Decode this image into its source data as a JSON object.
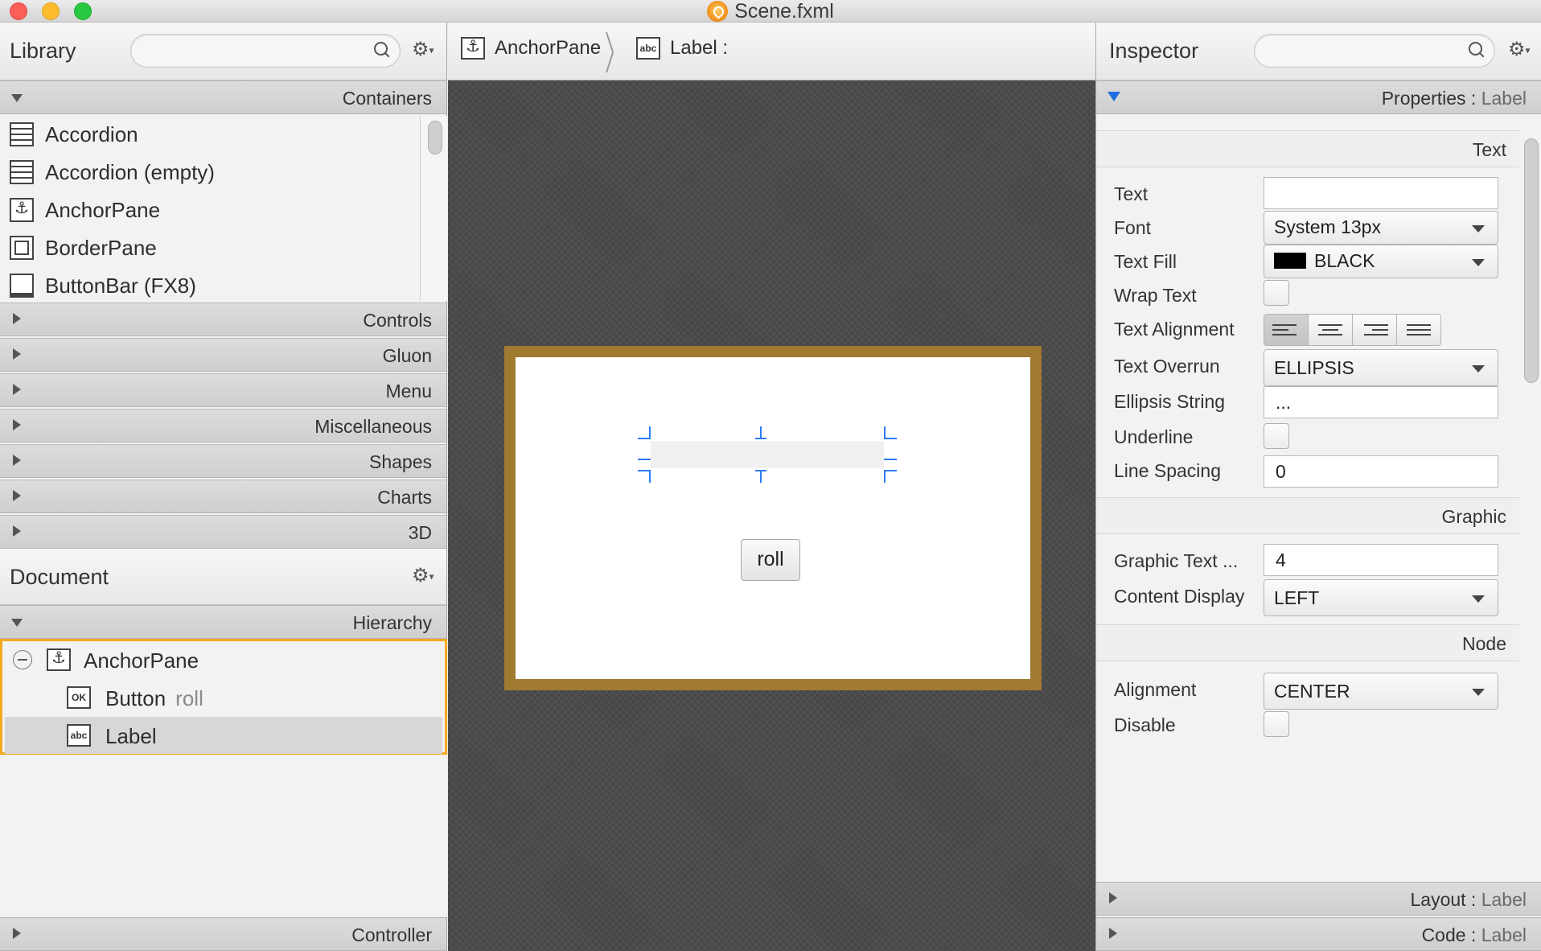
{
  "window": {
    "title": "Scene.fxml"
  },
  "library": {
    "title": "Library",
    "search_placeholder": "",
    "sections": {
      "containers": "Containers",
      "controls": "Controls",
      "gluon": "Gluon",
      "menu": "Menu",
      "miscellaneous": "Miscellaneous",
      "shapes": "Shapes",
      "charts": "Charts",
      "three_d": "3D"
    },
    "items": [
      {
        "label": "Accordion",
        "icon": "accordion-icon"
      },
      {
        "label": "Accordion  (empty)",
        "icon": "accordion-icon"
      },
      {
        "label": "AnchorPane",
        "icon": "anchor-icon"
      },
      {
        "label": "BorderPane",
        "icon": "borderpane-icon"
      },
      {
        "label": "ButtonBar  (FX8)",
        "icon": "buttonbar-icon"
      }
    ]
  },
  "document": {
    "title": "Document",
    "hierarchy_label": "Hierarchy",
    "controller_label": "Controller",
    "tree": {
      "root": {
        "label": "AnchorPane",
        "icon": "anchor-icon"
      },
      "children": [
        {
          "label": "Button",
          "sub": "roll",
          "icon_text": "OK"
        },
        {
          "label": "Label",
          "sub": "",
          "icon_text": "abc"
        }
      ]
    }
  },
  "breadcrumb": {
    "items": [
      {
        "label": "AnchorPane",
        "icon": "anchor-icon"
      },
      {
        "label": "Label :",
        "icon_text": "abc"
      }
    ]
  },
  "canvas": {
    "button_label": "roll",
    "colors": {
      "stage_border": "#a07a31",
      "selection_handle": "#2f7cf6"
    }
  },
  "inspector": {
    "title": "Inspector",
    "properties_header": {
      "label": "Properties",
      "sep": " : ",
      "target": "Label"
    },
    "groups": {
      "text": "Text",
      "graphic": "Graphic",
      "node": "Node"
    },
    "props": {
      "text": {
        "label": "Text",
        "value": ""
      },
      "font": {
        "label": "Font",
        "value": "System 13px"
      },
      "text_fill": {
        "label": "Text Fill",
        "value": "BLACK",
        "color": "#000000"
      },
      "wrap_text": {
        "label": "Wrap Text",
        "checked": false
      },
      "text_alignment": {
        "label": "Text Alignment",
        "options": [
          "left",
          "center",
          "right",
          "justify"
        ],
        "selected": "left"
      },
      "text_overrun": {
        "label": "Text Overrun",
        "value": "ELLIPSIS"
      },
      "ellipsis_string": {
        "label": "Ellipsis String",
        "value": "..."
      },
      "underline": {
        "label": "Underline",
        "checked": false
      },
      "line_spacing": {
        "label": "Line Spacing",
        "value": "0"
      },
      "graphic_text_gap": {
        "label": "Graphic Text ...",
        "value": "4"
      },
      "content_display": {
        "label": "Content Display",
        "value": "LEFT"
      },
      "alignment": {
        "label": "Alignment",
        "value": "CENTER"
      },
      "disable": {
        "label": "Disable",
        "checked": false
      }
    },
    "layout_header": {
      "label": "Layout",
      "sep": " : ",
      "target": "Label"
    },
    "code_header": {
      "label": "Code",
      "sep": " : ",
      "target": "Label"
    }
  }
}
